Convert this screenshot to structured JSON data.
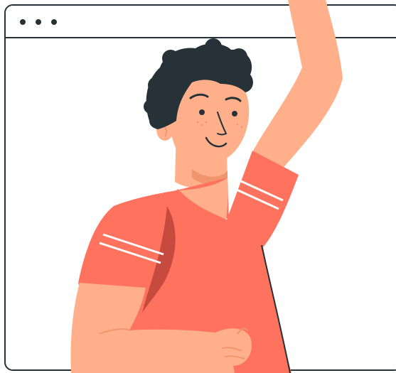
{
  "window": {
    "controls": [
      "dot-icon",
      "dot-icon",
      "dot-icon"
    ]
  },
  "illustration": {
    "subject": "person-waving-illustration",
    "colors": {
      "shirt": "#FF725E",
      "shirt_shadow": "#C64A3D",
      "skin": "#FFB08A",
      "skin_shade": "#F0956E",
      "hair": "#263238",
      "outline": "#263238",
      "stripe": "#FFFFFF"
    }
  }
}
